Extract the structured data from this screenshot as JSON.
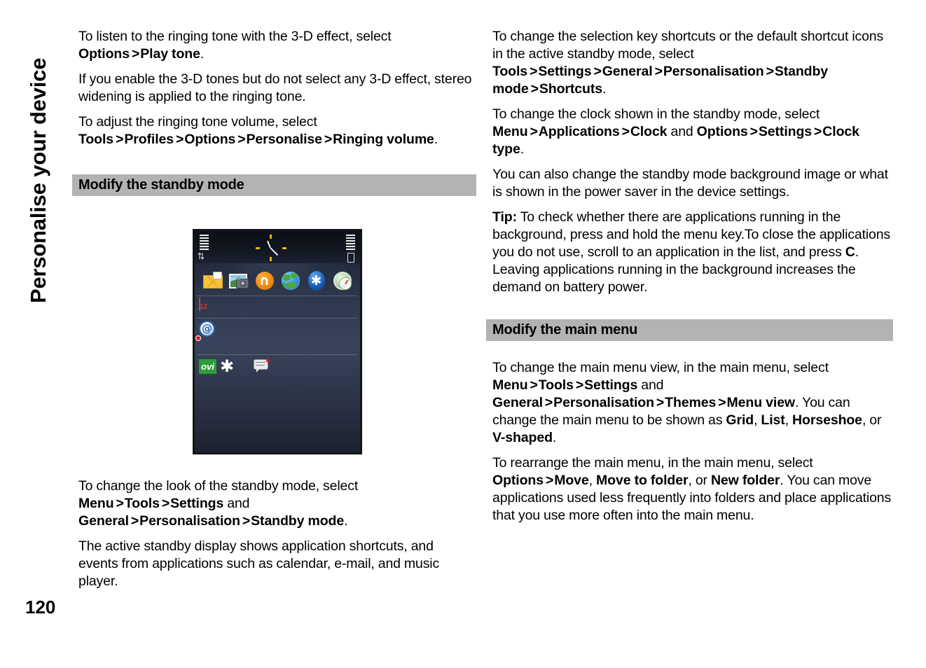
{
  "running_head": "Personalise your device",
  "page_number": "120",
  "left_column": {
    "paragraphs": [
      {
        "id": "p1",
        "runs": [
          {
            "t": "To listen to the ringing tone with the 3-D effect, select ",
            "b": false
          },
          {
            "t": "Options",
            "b": true
          },
          {
            "t": ">",
            "gt": true
          },
          {
            "t": "Play tone",
            "b": true
          },
          {
            "t": ".",
            "b": false
          }
        ]
      },
      {
        "id": "p2",
        "runs": [
          {
            "t": "If you enable the 3-D tones but do not select any 3-D effect, stereo widening is applied to the ringing tone.",
            "b": false
          }
        ]
      },
      {
        "id": "p3",
        "runs": [
          {
            "t": "To adjust the ringing tone volume, select ",
            "b": false
          },
          {
            "t": "Tools",
            "b": true
          },
          {
            "t": ">",
            "gt": true
          },
          {
            "t": "Profiles",
            "b": true
          },
          {
            "t": ">",
            "gt": true
          },
          {
            "t": "Options",
            "b": true
          },
          {
            "t": ">",
            "gt": true
          },
          {
            "t": "Personalise",
            "b": true
          },
          {
            "t": ">",
            "gt": true
          },
          {
            "t": "Ringing volume",
            "b": true
          },
          {
            "t": ".",
            "b": false
          }
        ]
      }
    ],
    "section_heading": "Modify the standby mode",
    "paragraphs_after_figure": [
      {
        "id": "p4",
        "runs": [
          {
            "t": "To change the look of the standby mode, select ",
            "b": false
          },
          {
            "t": "Menu",
            "b": true
          },
          {
            "t": ">",
            "gt": true
          },
          {
            "t": "Tools",
            "b": true
          },
          {
            "t": ">",
            "gt": true
          },
          {
            "t": "Settings",
            "b": true
          },
          {
            "t": " and ",
            "b": false
          },
          {
            "t": "General",
            "b": true
          },
          {
            "t": ">",
            "gt": true
          },
          {
            "t": "Personalisation",
            "b": true
          },
          {
            "t": ">",
            "gt": true
          },
          {
            "t": "Standby mode",
            "b": true
          },
          {
            "t": ".",
            "b": false
          }
        ]
      },
      {
        "id": "p5",
        "runs": [
          {
            "t": "The active standby display shows application shortcuts, and events from applications such as calendar, e-mail, and music player.",
            "b": false
          }
        ]
      }
    ]
  },
  "right_column": {
    "paragraphs": [
      {
        "id": "r1",
        "runs": [
          {
            "t": "To change the selection key shortcuts or the default shortcut icons in the active standby mode, select ",
            "b": false
          },
          {
            "t": "Tools",
            "b": true
          },
          {
            "t": ">",
            "gt": true
          },
          {
            "t": "Settings",
            "b": true
          },
          {
            "t": ">",
            "gt": true
          },
          {
            "t": "General",
            "b": true
          },
          {
            "t": ">",
            "gt": true
          },
          {
            "t": "Personalisation",
            "b": true
          },
          {
            "t": ">",
            "gt": true
          },
          {
            "t": "Standby mode",
            "b": true
          },
          {
            "t": ">",
            "gt": true
          },
          {
            "t": "Shortcuts",
            "b": true
          },
          {
            "t": ".",
            "b": false
          }
        ]
      },
      {
        "id": "r2",
        "runs": [
          {
            "t": "To change the clock shown in the standby mode, select ",
            "b": false
          },
          {
            "t": "Menu",
            "b": true
          },
          {
            "t": ">",
            "gt": true
          },
          {
            "t": "Applications",
            "b": true
          },
          {
            "t": ">",
            "gt": true
          },
          {
            "t": "Clock",
            "b": true
          },
          {
            "t": " and ",
            "b": false
          },
          {
            "t": "Options",
            "b": true
          },
          {
            "t": ">",
            "gt": true
          },
          {
            "t": "Settings",
            "b": true
          },
          {
            "t": ">",
            "gt": true
          },
          {
            "t": "Clock type",
            "b": true
          },
          {
            "t": ".",
            "b": false
          }
        ]
      },
      {
        "id": "r3",
        "runs": [
          {
            "t": "You can also change the standby mode background image or what is shown in the power saver in the device settings.",
            "b": false
          }
        ]
      },
      {
        "id": "r4",
        "runs": [
          {
            "t": "Tip:",
            "b": true
          },
          {
            "t": " To check whether there are applications running in the background, press and hold the menu key.To close the applications you do not use, scroll to an application in the list, and press ",
            "b": false
          },
          {
            "t": "C",
            "b": true
          },
          {
            "t": ". Leaving applications running in the background increases the demand on battery power.",
            "b": false
          }
        ]
      }
    ],
    "section_heading": "Modify the main menu",
    "paragraphs_after_heading": [
      {
        "id": "r5",
        "runs": [
          {
            "t": "To change the main menu view, in the main menu, select ",
            "b": false
          },
          {
            "t": "Menu",
            "b": true
          },
          {
            "t": ">",
            "gt": true
          },
          {
            "t": "Tools",
            "b": true
          },
          {
            "t": ">",
            "gt": true
          },
          {
            "t": "Settings",
            "b": true
          },
          {
            "t": " and ",
            "b": false
          },
          {
            "t": "General",
            "b": true
          },
          {
            "t": ">",
            "gt": true
          },
          {
            "t": "Personalisation",
            "b": true
          },
          {
            "t": ">",
            "gt": true
          },
          {
            "t": "Themes",
            "b": true
          },
          {
            "t": ">",
            "gt": true
          },
          {
            "t": "Menu view",
            "b": true
          },
          {
            "t": ". You can change the main menu to be shown as ",
            "b": false
          },
          {
            "t": "Grid",
            "b": true
          },
          {
            "t": ", ",
            "b": false
          },
          {
            "t": "List",
            "b": true
          },
          {
            "t": ", ",
            "b": false
          },
          {
            "t": "Horseshoe",
            "b": true
          },
          {
            "t": ", or ",
            "b": false
          },
          {
            "t": "V-shaped",
            "b": true
          },
          {
            "t": ".",
            "b": false
          }
        ]
      },
      {
        "id": "r6",
        "runs": [
          {
            "t": "To rearrange the main menu, in the main menu, select ",
            "b": false
          },
          {
            "t": "Options",
            "b": true
          },
          {
            "t": ">",
            "gt": true
          },
          {
            "t": "Move",
            "b": true
          },
          {
            "t": ", ",
            "b": false
          },
          {
            "t": "Move to folder",
            "b": true
          },
          {
            "t": ", or ",
            "b": false
          },
          {
            "t": "New folder",
            "b": true
          },
          {
            "t": ". You can move applications used less frequently into folders and place applications that you use more often into the main menu.",
            "b": false
          }
        ]
      }
    ]
  },
  "figure": {
    "caption": "",
    "device_screen": {
      "status_bar": {
        "signal_icon": "signal-bars-icon",
        "battery_icon": "battery-bars-icon",
        "clock_icon": "analog-clock-icon",
        "data_transfer_icon": "data-transfer-arrows-icon"
      },
      "shortcut_icons": [
        "messaging-envelope-icon",
        "gallery-camera-icon",
        "ovi-store-n-icon",
        "web-browser-globe-icon",
        "bluetooth-icon",
        "maps-compass-icon"
      ],
      "ovi_label": "ovi",
      "calendar_day": "12",
      "at_symbol": "@",
      "event_icons": [
        "calendar-icon",
        "email-at-icon",
        "new-message-envelope-icon",
        "ovi-badge-icon",
        "asterisk-icon",
        "new-message-bubble-icon"
      ]
    }
  },
  "colors": {
    "heading_bar": "#b3b3b3",
    "text": "#000000",
    "page_background": "#ffffff",
    "phone_screen": "#2b3448"
  }
}
